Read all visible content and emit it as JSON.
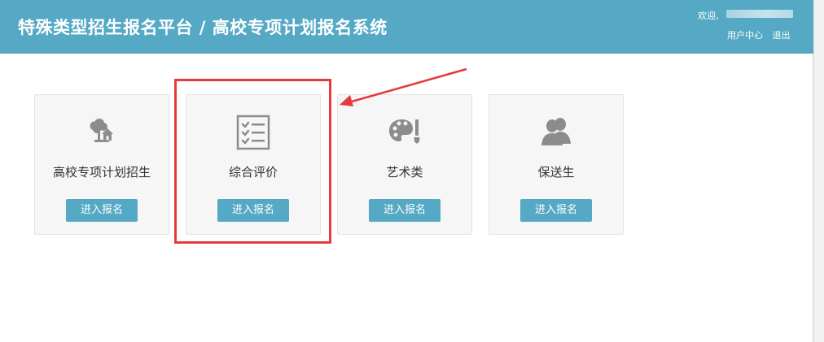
{
  "header": {
    "title": "特殊类型招生报名平台 / 高校专项计划报名系统",
    "welcome": "欢迎,",
    "user_center": "用户中心",
    "logout": "退出"
  },
  "colors": {
    "primary": "#55a9c4",
    "highlight": "#e8393a",
    "card_bg": "#f6f6f6",
    "icon_gray": "#8c8c8c"
  },
  "cards": [
    {
      "label": "高校专项计划招生",
      "button": "进入报名",
      "icon": "tree-house-icon"
    },
    {
      "label": "综合评价",
      "button": "进入报名",
      "icon": "checklist-icon"
    },
    {
      "label": "艺术类",
      "button": "进入报名",
      "icon": "palette-icon"
    },
    {
      "label": "保送生",
      "button": "进入报名",
      "icon": "users-icon"
    }
  ]
}
